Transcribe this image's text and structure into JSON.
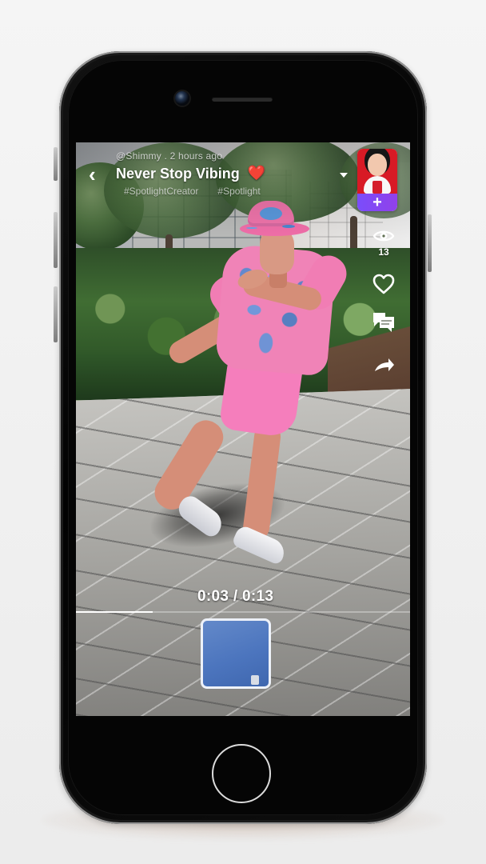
{
  "post": {
    "author": "@Shimmy",
    "separator": ".",
    "timestamp": "2 hours ago",
    "title": "Never Stop Vibing",
    "title_emoji": "❤️",
    "hashtags": [
      "#SpotlightCreator",
      "#Spotlight"
    ]
  },
  "engagement": {
    "views": "13"
  },
  "player": {
    "current_time": "0:03",
    "separator": " / ",
    "duration": "0:13",
    "progress_fraction": 0.23
  },
  "icons": {
    "back": "chevron-left",
    "dropdown": "caret-down",
    "creator_add": "plus",
    "views": "eye",
    "like": "heart-outline",
    "comment": "chat-bubbles",
    "share": "share-arrow"
  },
  "colors": {
    "title_emoji": "#e00b16",
    "add_button_start": "#7a4dfb",
    "add_button_end": "#9141ea"
  }
}
